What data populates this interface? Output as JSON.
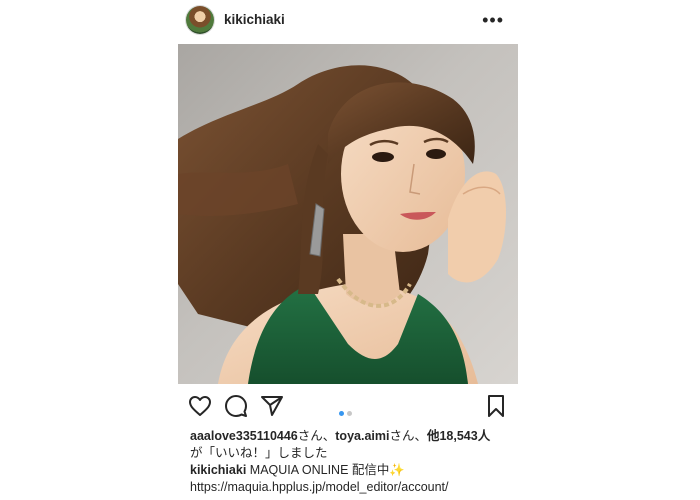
{
  "post": {
    "username": "kikichiaki",
    "more_label": "•••",
    "photo_description_icon": "portrait-photo"
  },
  "pagination": {
    "total": 2,
    "current": 1
  },
  "likes": {
    "user1": "aaalove335110446",
    "suffix1": "さん、",
    "user2": "toya.aimi",
    "suffix2": "さん、",
    "others": "他18,543人",
    "line2": "が「いいね！」しました"
  },
  "caption": {
    "username": "kikichiaki",
    "text": "MAQUIA ONLINE 配信中",
    "emoji": "✨",
    "link": "https://maquia.hpplus.jp/model_editor/account/"
  },
  "colors": {
    "accent": "#3897f0",
    "text": "#262626",
    "dress": "#1f6a3c"
  }
}
